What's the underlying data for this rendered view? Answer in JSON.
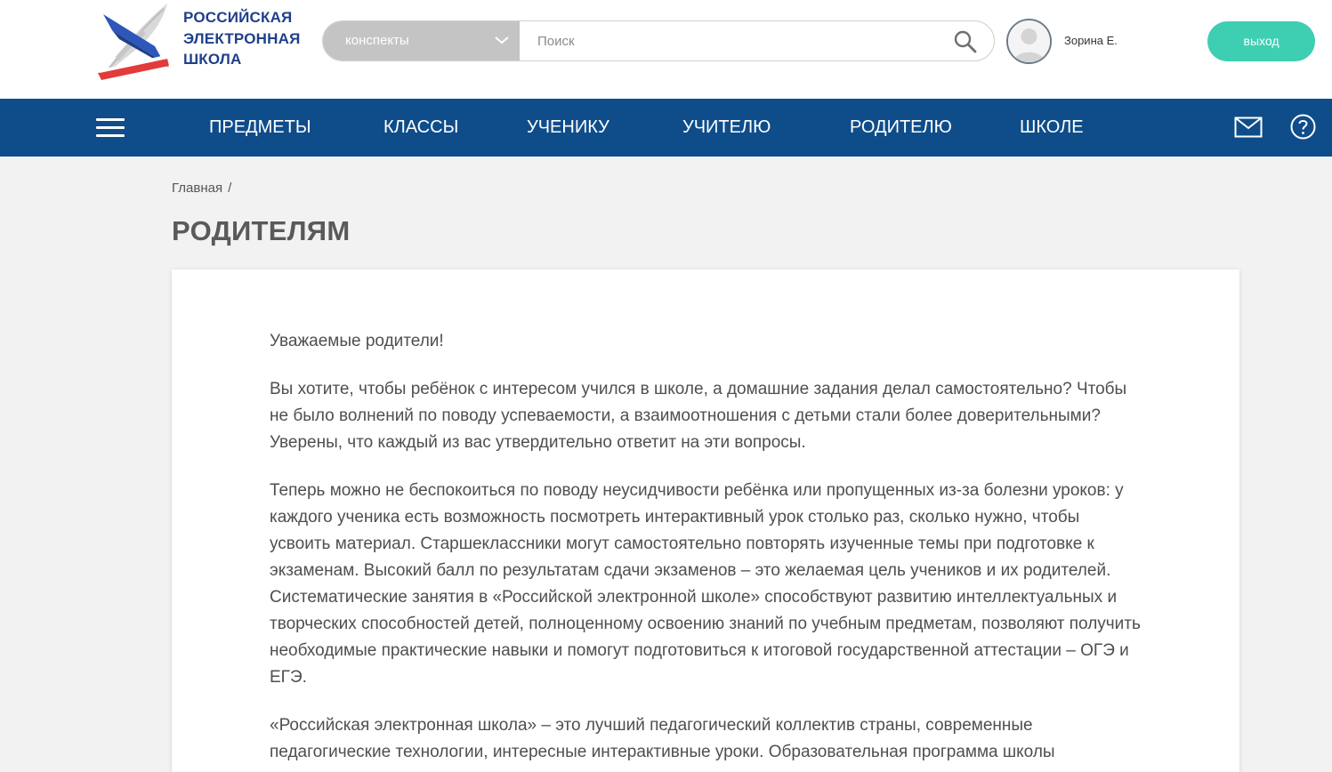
{
  "header": {
    "logo": {
      "line1": "РОССИЙСКАЯ",
      "line2": "ЭЛЕКТРОННАЯ",
      "line3": "ШКОЛА",
      "icon": "quill-book-logo"
    },
    "search": {
      "category": "конспекты",
      "placeholder": "Поиск",
      "dropdown_icon": "chevron-down-icon",
      "search_icon": "search-icon"
    },
    "user": {
      "name": "Зорина Е.",
      "avatar_icon": "user-avatar-icon"
    },
    "logout_label": "выход"
  },
  "nav": {
    "menu_icon": "hamburger-icon",
    "items": [
      "ПРЕДМЕТЫ",
      "КЛАССЫ",
      "УЧЕНИКУ",
      "УЧИТЕЛЮ",
      "РОДИТЕЛЮ",
      "ШКОЛЕ"
    ],
    "mail_icon": "mail-icon",
    "help_icon": "help-icon"
  },
  "breadcrumb": {
    "home": "Главная",
    "separator": "/"
  },
  "page": {
    "title": "РОДИТЕЛЯМ",
    "paragraphs": [
      "Уважаемые родители!",
      "Вы хотите, чтобы ребёнок с интересом учился в школе, а домашние задания делал самостоятельно? Чтобы не было волнений по поводу успеваемости, а взаимоотношения с детьми стали более доверительными? Уверены, что каждый из вас утвердительно ответит на эти вопросы.",
      "Теперь можно не беспокоиться по поводу неусидчивости ребёнка или пропущенных из-за болезни уроков: у каждого ученика есть возможность посмотреть интерактивный урок столько раз, сколько нужно, чтобы усвоить материал. Старшеклассники могут самостоятельно повторять изученные темы при подготовке к экзаменам. Высокий балл по результатам сдачи экзаменов – это желаемая цель учеников и их родителей. Систематические занятия в «Российской электронной школе» способствуют развитию интеллектуальных и творческих способностей детей, полноценному освоению знаний по учебным предметам, позволяют получить необходимые практические навыки и помогут подготовиться к итоговой государственной аттестации – ОГЭ и ЕГЭ.",
      "«Российская электронная школа» – это лучший педагогический коллектив страны, современные педагогические технологии, интересные интерактивные уроки. Образовательная программа школы"
    ]
  },
  "colors": {
    "nav_bg": "#0f4d8a",
    "logout_bg": "#3ecfb2",
    "select_bg": "#c4c4c4",
    "logo_text": "#1f3f8a",
    "page_bg": "#f2f2f2"
  }
}
